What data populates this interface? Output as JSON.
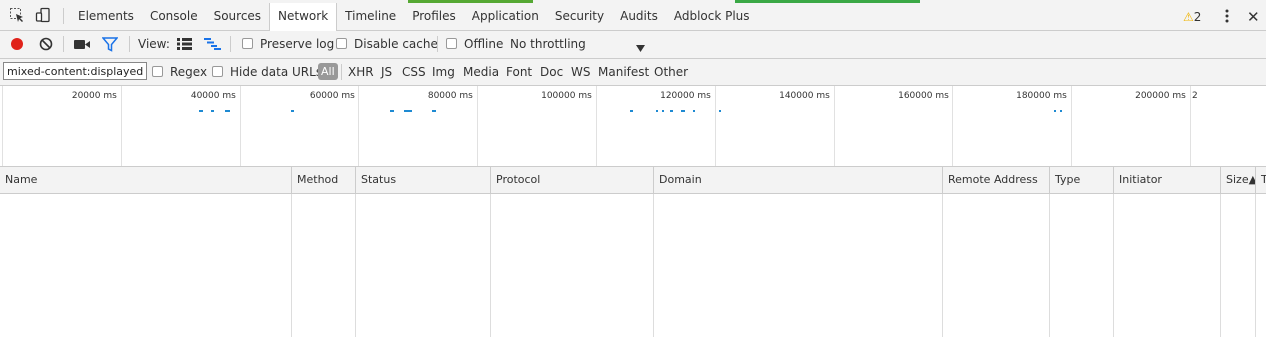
{
  "tabs": [
    {
      "label": "Elements"
    },
    {
      "label": "Console"
    },
    {
      "label": "Sources"
    },
    {
      "label": "Network",
      "active": true
    },
    {
      "label": "Timeline"
    },
    {
      "label": "Profiles"
    },
    {
      "label": "Application"
    },
    {
      "label": "Security"
    },
    {
      "label": "Audits"
    },
    {
      "label": "Adblock Plus"
    }
  ],
  "warnings": {
    "count": "2",
    "icon": "warning-icon"
  },
  "toolbar": {
    "view_label": "View:",
    "preserve_log": "Preserve log",
    "disable_cache": "Disable cache",
    "offline": "Offline",
    "throttling": "No throttling"
  },
  "filter": {
    "value": "mixed-content:displayed",
    "regex": "Regex",
    "hide_data_urls": "Hide data URLs",
    "types": [
      "All",
      "XHR",
      "JS",
      "CSS",
      "Img",
      "Media",
      "Font",
      "Doc",
      "WS",
      "Manifest",
      "Other"
    ]
  },
  "overview": {
    "ticks": [
      "20000 ms",
      "40000 ms",
      "60000 ms",
      "80000 ms",
      "100000 ms",
      "120000 ms",
      "140000 ms",
      "160000 ms",
      "180000 ms",
      "200000 ms",
      "2"
    ]
  },
  "columns": [
    "Name",
    "Method",
    "Status",
    "Protocol",
    "Domain",
    "Remote Address",
    "Type",
    "Initiator",
    "Size▲",
    "Ti"
  ],
  "colors": {
    "record": "#e0221a",
    "accent": "#1a73e8",
    "bar": "#1e8ad2",
    "warn": "#f0b400"
  }
}
